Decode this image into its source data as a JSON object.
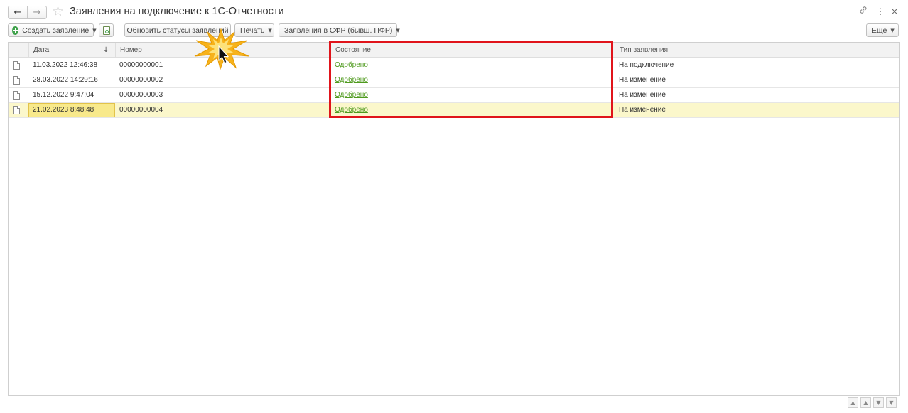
{
  "window": {
    "title": "Заявления на подключение к 1С-Отчетности",
    "back_icon": "←",
    "forward_icon": "→",
    "favorite_icon": "☆",
    "link_icon": "🔗",
    "more_icon": "⋮",
    "close_icon": "×"
  },
  "toolbar": {
    "create_label": "Создать заявление",
    "update_statuses_label": "Обновить статусы заявлений",
    "print_label": "Печать",
    "sfr_label": "Заявления в СФР (бывш. ПФР)",
    "more_label": "Еще",
    "caret": "▼"
  },
  "table": {
    "columns": {
      "date": "Дата",
      "number": "Номер",
      "status": "Состояние",
      "type": "Тип заявления"
    },
    "sort_icon": "↓",
    "rows": [
      {
        "date": "11.03.2022 12:46:38",
        "number": "00000000001",
        "status": "Одобрено",
        "type": "На подключение"
      },
      {
        "date": "28.03.2022 14:29:16",
        "number": "00000000002",
        "status": "Одобрено",
        "type": "На изменение"
      },
      {
        "date": "15.12.2022 9:47:04",
        "number": "00000000003",
        "status": "Одобрено",
        "type": "На изменение"
      },
      {
        "date": "21.02.2023 8:48:48",
        "number": "00000000004",
        "status": "Одобрено",
        "type": "На изменение"
      }
    ]
  },
  "scroll_nav": {
    "first": "▲",
    "up": "▲",
    "down": "▼",
    "last": "▼"
  },
  "colors": {
    "link": "#4f9a1e",
    "selected_row": "#fbf7cb",
    "highlight_box": "#e0141b"
  }
}
